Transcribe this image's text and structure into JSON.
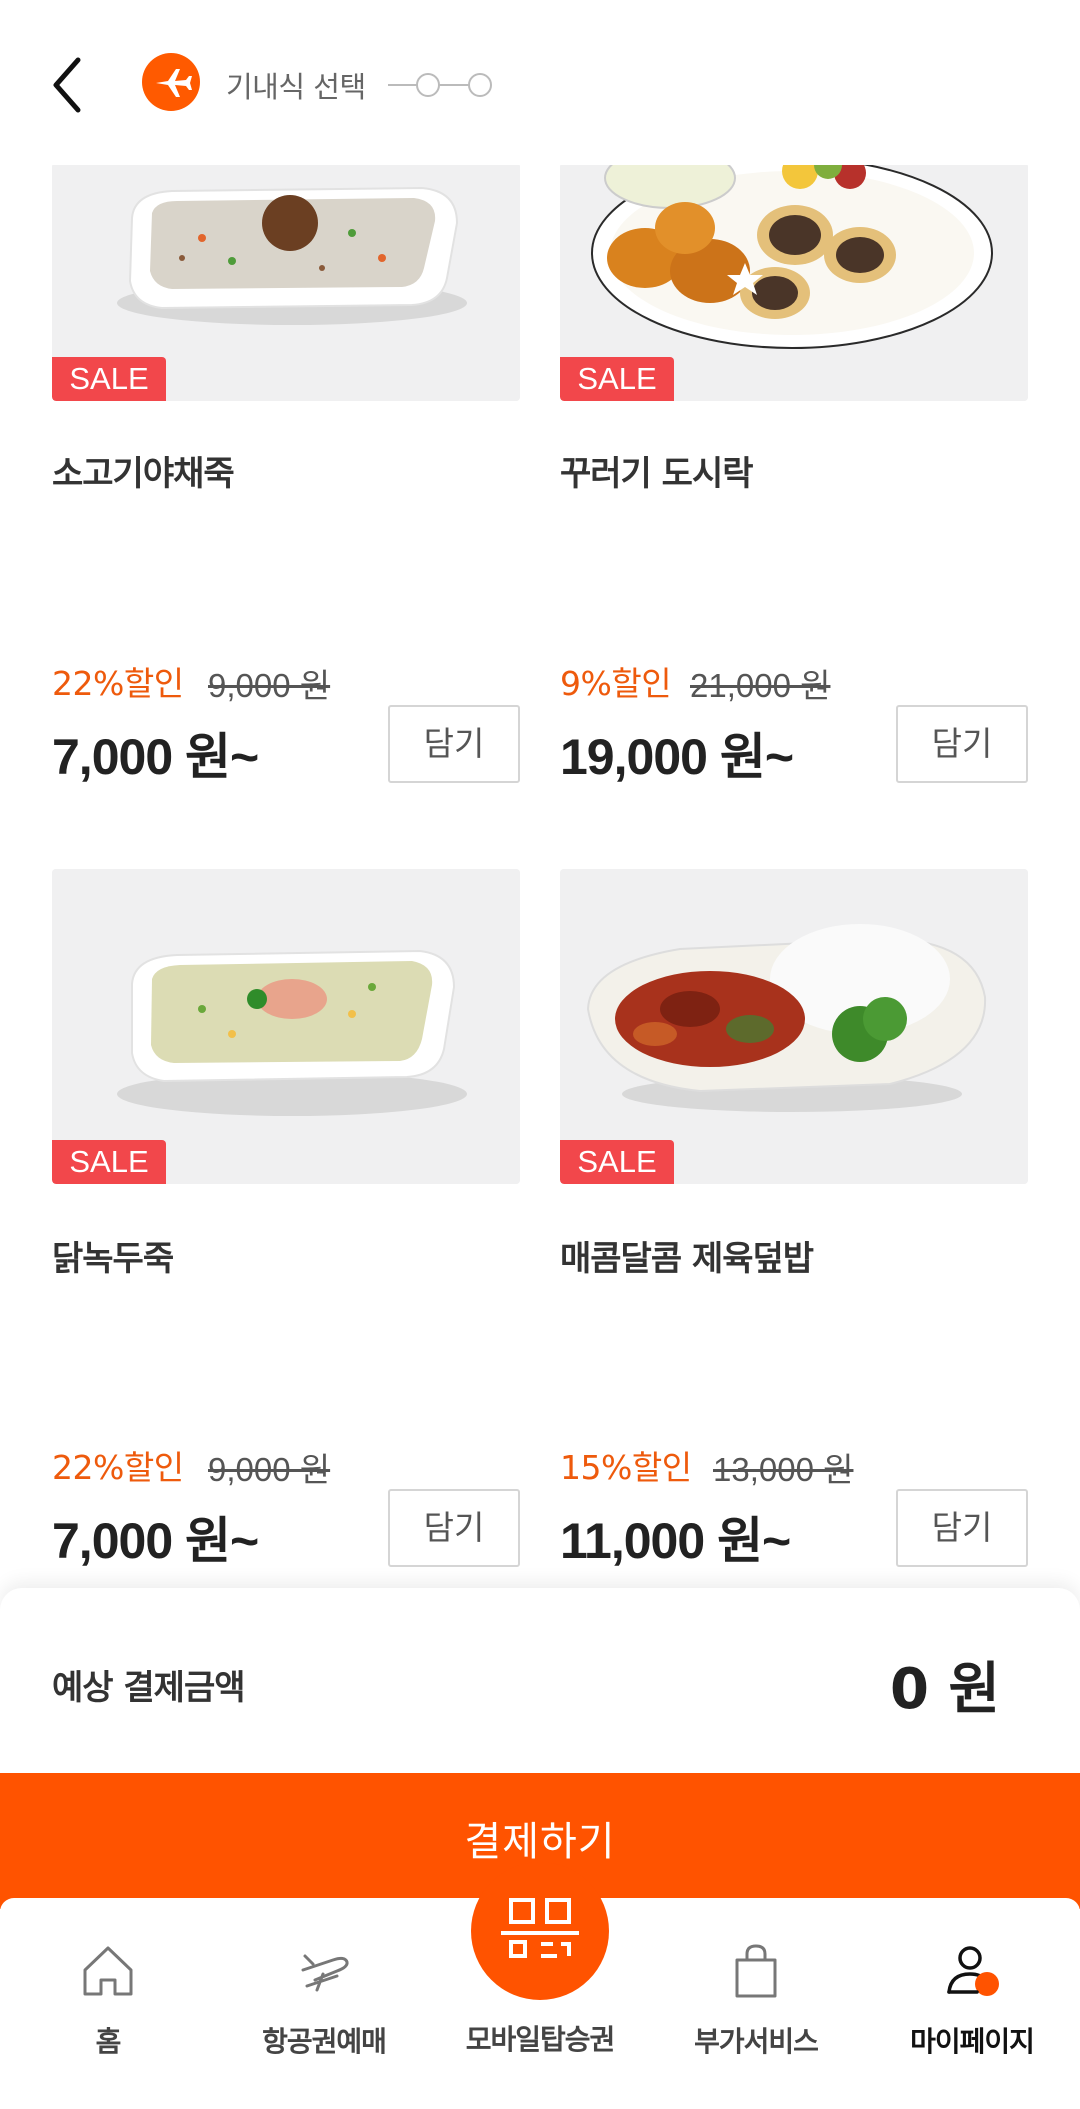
{
  "header": {
    "title": "기내식 선택"
  },
  "products": [
    {
      "name": "소고기야채죽",
      "sale_badge": "SALE",
      "discount": "22%할인",
      "original_price": "9,000 원",
      "price": "7,000 원~",
      "cart_label": "담기"
    },
    {
      "name": "꾸러기 도시락",
      "sale_badge": "SALE",
      "discount": "9%할인",
      "original_price": "21,000 원",
      "price": "19,000 원~",
      "cart_label": "담기"
    },
    {
      "name": "닭녹두죽",
      "sale_badge": "SALE",
      "discount": "22%할인",
      "original_price": "9,000 원",
      "price": "7,000 원~",
      "cart_label": "담기"
    },
    {
      "name": "매콤달콤 제육덮밥",
      "sale_badge": "SALE",
      "discount": "15%할인",
      "original_price": "13,000 원",
      "price": "11,000 원~",
      "cart_label": "담기"
    }
  ],
  "summary": {
    "label": "예상 결제금액",
    "amount": "0 원"
  },
  "pay_button": "결제하기",
  "bottom_nav": {
    "items": [
      {
        "label": "홈",
        "icon": "home-icon"
      },
      {
        "label": "항공권예매",
        "icon": "plane-ticket-icon"
      },
      {
        "label": "모바일탑승권",
        "icon": "qr-code-icon"
      },
      {
        "label": "부가서비스",
        "icon": "shopping-bag-icon"
      },
      {
        "label": "마이페이지",
        "icon": "user-icon"
      }
    ],
    "active_index": 4
  },
  "colors": {
    "accent": "#ff5300",
    "sale": "#f2474b",
    "discount": "#ee5a0c"
  }
}
